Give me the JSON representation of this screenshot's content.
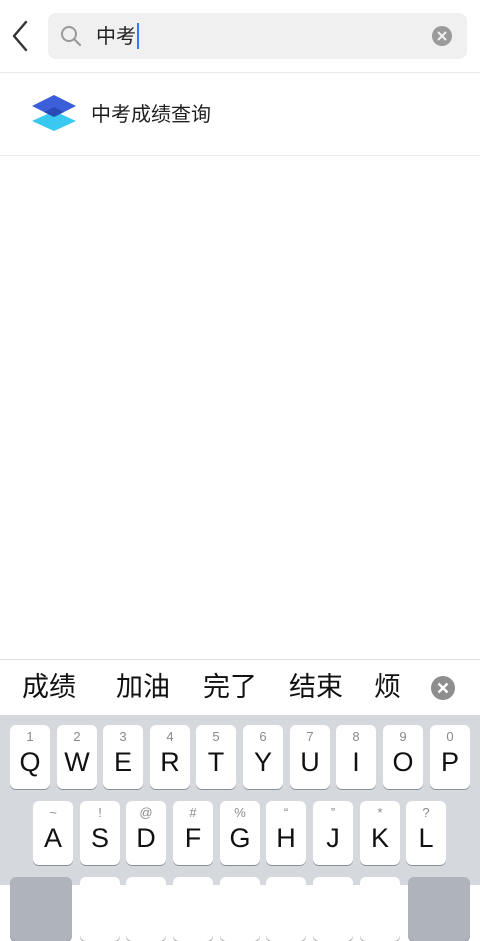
{
  "search": {
    "query": "中考"
  },
  "results": [
    {
      "label": "中考成绩查询",
      "icon": "layers-app-icon"
    }
  ],
  "candidates": [
    "成绩",
    "加油",
    "完了",
    "结束",
    "烦"
  ],
  "keyboard": {
    "row1": [
      {
        "sub": "1",
        "main": "Q"
      },
      {
        "sub": "2",
        "main": "W"
      },
      {
        "sub": "3",
        "main": "E"
      },
      {
        "sub": "4",
        "main": "R"
      },
      {
        "sub": "5",
        "main": "T"
      },
      {
        "sub": "6",
        "main": "Y"
      },
      {
        "sub": "7",
        "main": "U"
      },
      {
        "sub": "8",
        "main": "I"
      },
      {
        "sub": "9",
        "main": "O"
      },
      {
        "sub": "0",
        "main": "P"
      }
    ],
    "row2": [
      {
        "sub": "~",
        "main": "A"
      },
      {
        "sub": "!",
        "main": "S"
      },
      {
        "sub": "@",
        "main": "D"
      },
      {
        "sub": "#",
        "main": "F"
      },
      {
        "sub": "%",
        "main": "G"
      },
      {
        "sub": "“",
        "main": "H"
      },
      {
        "sub": "”",
        "main": "J"
      },
      {
        "sub": "*",
        "main": "K"
      },
      {
        "sub": "?",
        "main": "L"
      }
    ]
  },
  "colors": {
    "accent": "#2f7ff0",
    "keyboard_bg": "#d5d8dd",
    "search_bg": "#f0f0f0"
  }
}
